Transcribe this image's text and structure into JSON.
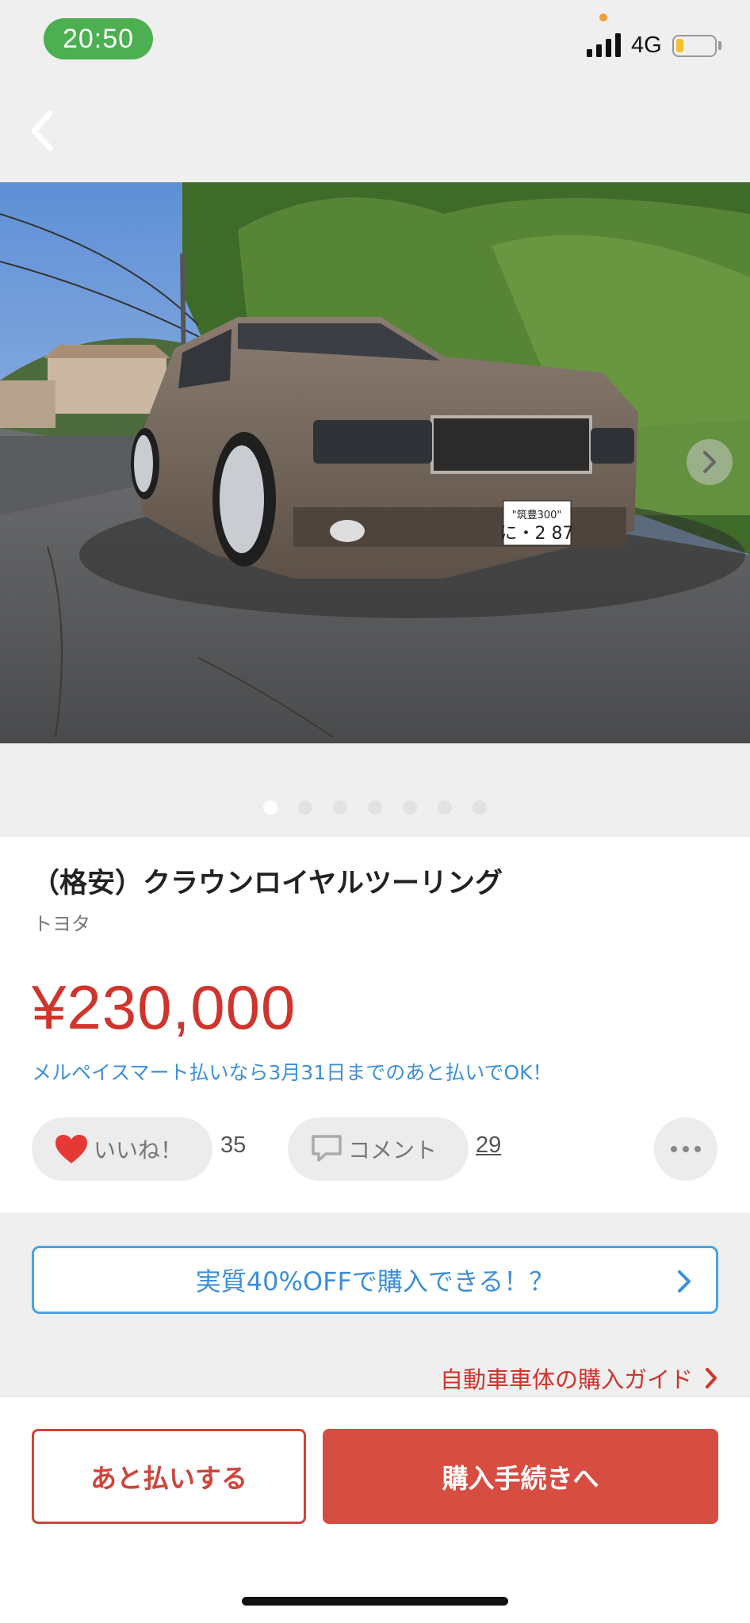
{
  "status_bar": {
    "time": "20:50",
    "network": "4G",
    "battery_level": 0.2
  },
  "nav": {
    "back_icon": "chevron-left-icon"
  },
  "photo": {
    "plate_top": "\"筑豊300\"",
    "plate_bottom": "に・2 87",
    "total_photos": 7,
    "active_index": 0
  },
  "item": {
    "title": "（格安）クラウンロイヤルツーリング",
    "brand": "トヨタ",
    "price": "¥230,000",
    "promo": "メルペイスマート払いなら3月31日までのあと払いでOK！"
  },
  "actions": {
    "like_label": "いいね！",
    "like_count": "35",
    "comment_label": "コメント",
    "comment_count": "29"
  },
  "offer": {
    "label": "実質40%OFFで購入できる！？"
  },
  "guide": {
    "label": "自動車車体の購入ガイド"
  },
  "bottom": {
    "later_label": "あと払いする",
    "buy_label": "購入手続きへ"
  },
  "colors": {
    "accent_red": "#d0342c",
    "link_blue": "#3d8fd8",
    "status_green": "#4caf50"
  }
}
